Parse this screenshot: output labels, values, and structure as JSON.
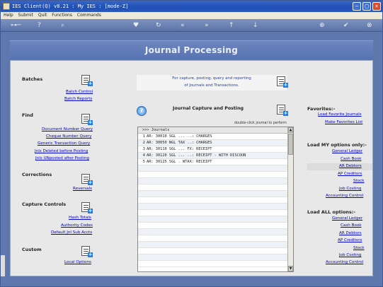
{
  "window": {
    "title": "IES Client(Q) v8.21 : My IES :     [mode-Z]",
    "controls": [
      "minimize-icon",
      "maximize-icon",
      "close-icon"
    ]
  },
  "menu": [
    "Help",
    "Submit",
    "Quit",
    "Functions",
    "Commands"
  ],
  "toolbar_icons": [
    "key-icon",
    "help-icon",
    "search-icon",
    "heart-icon",
    "refresh-icon",
    "back-icon",
    "forward-icon",
    "up-icon",
    "down-icon",
    "add-icon",
    "check-icon",
    "close-icon"
  ],
  "banner": {
    "title": "Journal Processing"
  },
  "left": {
    "batches": {
      "title": "Batches",
      "links": [
        "Batch Control",
        "Batch Reports"
      ]
    },
    "find": {
      "title": "Find",
      "links": [
        "Document Number Query",
        "Cheque Number Query",
        "Generic Transaction Query",
        "Jnls Deleted before Posting",
        "Jnls UNposted after Posting"
      ]
    },
    "corrections": {
      "title": "Corrections",
      "links": [
        "Reversals"
      ]
    },
    "capture_controls": {
      "title": "Capture Controls",
      "links": [
        "Hash Totals",
        "Authority Codes",
        "Default Jnl Sub Accts"
      ]
    },
    "custom": {
      "title": "Custom",
      "links": [
        "Local Options"
      ]
    }
  },
  "center": {
    "info_line1": "For capture, posting, query and reporting",
    "info_line2": "of Journals and Transactions.",
    "capture_title": "Journal Capture and Posting",
    "hint": "double-click journal to perform",
    "grid_header": ">>> Journals",
    "rows": [
      {
        "n": "1",
        "text": "AR: 30010 SGL ... ..: CHARGES"
      },
      {
        "n": "2",
        "text": "AR: 30050 NGL TAX ..: CHARGES"
      },
      {
        "n": "3",
        "text": "AR: 30110 SGL ... FX: RECEIPT"
      },
      {
        "n": "4",
        "text": "AR: 30120 SGL ... ..: RECEIPT - WITH DISCOUN"
      },
      {
        "n": "5",
        "text": "AR: 30125 SGL . WTAX: RECEIPT"
      }
    ]
  },
  "right": {
    "favorites": {
      "title": "Favorites:-",
      "links": [
        "Load Favorite Journals",
        "Make Favorites List"
      ]
    },
    "my_options": {
      "title": "Load MY options only:-",
      "links": [
        "General Ledger",
        "Cash Book",
        "AR Debtors",
        "AP Creditors",
        "Stock",
        "Job Costing",
        "Accounting Control"
      ]
    },
    "all_options": {
      "title": "Load ALL options:-",
      "links": [
        "General Ledger",
        "Cash Book",
        "AR Debtors",
        "AP Creditors",
        "Stock",
        "Job Costing",
        "Accounting Control"
      ]
    }
  }
}
